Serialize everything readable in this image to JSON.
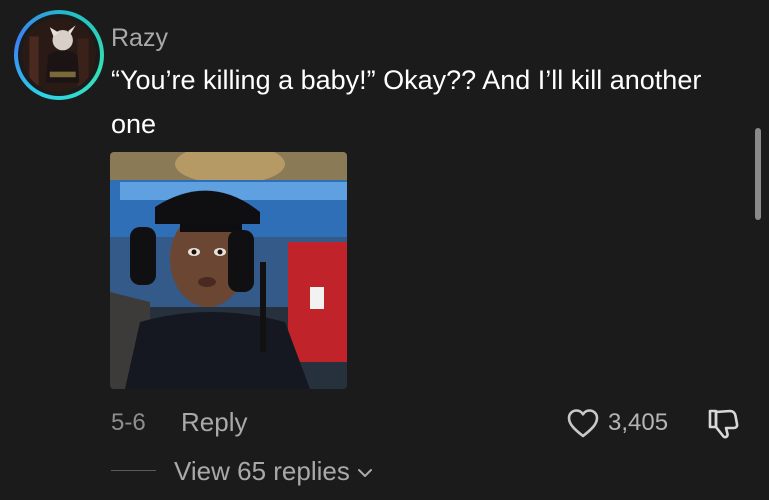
{
  "comment": {
    "username": "Razy",
    "text": "“You’re killing a baby!” Okay?? And I’ll kill another one",
    "date": "5-6",
    "reply_label": "Reply",
    "like_count": "3,405",
    "view_replies_label": "View 65 replies"
  },
  "icons": {
    "like": "heart-outline-icon",
    "dislike": "thumbs-down-icon",
    "expand": "chevron-down-icon"
  },
  "colors": {
    "background": "#1b1b1b",
    "avatar_ring": "#2dd4e6",
    "text_primary": "#ffffff",
    "text_secondary": "#a9a9a9"
  }
}
